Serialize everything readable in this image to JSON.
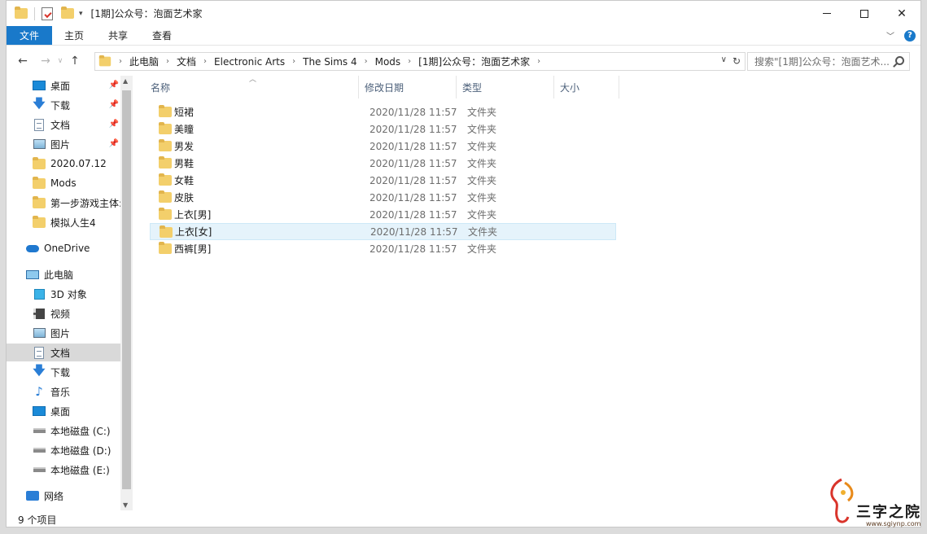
{
  "window": {
    "title": "[1期]公众号：泡面艺术家"
  },
  "ribbon": {
    "tabs": [
      {
        "label": "文件"
      },
      {
        "label": "主页"
      },
      {
        "label": "共享"
      },
      {
        "label": "查看"
      }
    ]
  },
  "address": {
    "breadcrumbs": [
      "此电脑",
      "文档",
      "Electronic Arts",
      "The Sims 4",
      "Mods",
      "[1期]公众号：泡面艺术家"
    ]
  },
  "search": {
    "placeholder": "搜索\"[1期]公众号：泡面艺术..."
  },
  "navpane": {
    "items": [
      {
        "label": "桌面",
        "icon": "desktop-icon",
        "pinned": true
      },
      {
        "label": "下载",
        "icon": "download-icon",
        "pinned": true
      },
      {
        "label": "文档",
        "icon": "document-icon",
        "pinned": true
      },
      {
        "label": "图片",
        "icon": "pictures-icon",
        "pinned": true
      },
      {
        "label": "2020.07.12",
        "icon": "folder-icon"
      },
      {
        "label": "Mods",
        "icon": "folder-icon"
      },
      {
        "label": "第一步游戏主体:",
        "icon": "folder-icon"
      },
      {
        "label": "模拟人生4",
        "icon": "folder-icon"
      },
      {
        "label": "OneDrive",
        "icon": "cloud-icon"
      },
      {
        "label": "此电脑",
        "icon": "computer-icon"
      },
      {
        "label": "3D 对象",
        "icon": "3d-objects-icon"
      },
      {
        "label": "视频",
        "icon": "video-icon"
      },
      {
        "label": "图片",
        "icon": "pictures-icon"
      },
      {
        "label": "文档",
        "icon": "document-icon",
        "selected": true
      },
      {
        "label": "下载",
        "icon": "download-icon"
      },
      {
        "label": "音乐",
        "icon": "music-icon"
      },
      {
        "label": "桌面",
        "icon": "desktop-icon"
      },
      {
        "label": "本地磁盘 (C:)",
        "icon": "drive-icon"
      },
      {
        "label": "本地磁盘 (D:)",
        "icon": "drive-icon"
      },
      {
        "label": "本地磁盘 (E:)",
        "icon": "drive-icon"
      },
      {
        "label": "网络",
        "icon": "network-icon"
      }
    ]
  },
  "filelist": {
    "columns": {
      "name": "名称",
      "date": "修改日期",
      "type": "类型",
      "size": "大小"
    },
    "rows": [
      {
        "name": "短裙",
        "date": "2020/11/28 11:57",
        "type": "文件夹"
      },
      {
        "name": "美瞳",
        "date": "2020/11/28 11:57",
        "type": "文件夹"
      },
      {
        "name": "男发",
        "date": "2020/11/28 11:57",
        "type": "文件夹"
      },
      {
        "name": "男鞋",
        "date": "2020/11/28 11:57",
        "type": "文件夹"
      },
      {
        "name": "女鞋",
        "date": "2020/11/28 11:57",
        "type": "文件夹"
      },
      {
        "name": "皮肤",
        "date": "2020/11/28 11:57",
        "type": "文件夹"
      },
      {
        "name": "上衣[男]",
        "date": "2020/11/28 11:57",
        "type": "文件夹"
      },
      {
        "name": "上衣[女]",
        "date": "2020/11/28 11:57",
        "type": "文件夹",
        "selected": true
      },
      {
        "name": "西裤[男]",
        "date": "2020/11/28 11:57",
        "type": "文件夹"
      }
    ]
  },
  "status": {
    "item_count": "9 个项目"
  },
  "watermark": {
    "text": "三字之院",
    "url": "www.sgiynp.com"
  }
}
